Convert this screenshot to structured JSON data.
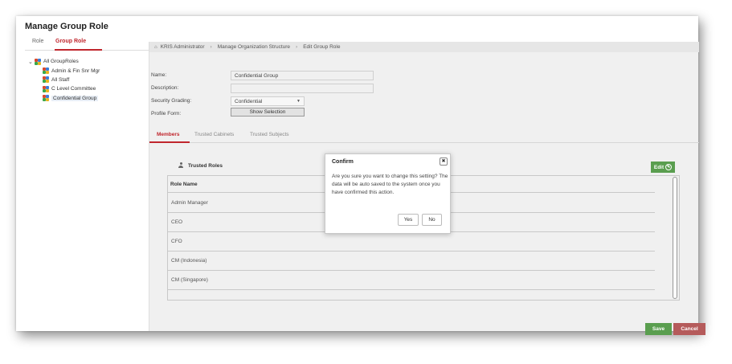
{
  "page": {
    "title": "Manage Group Role"
  },
  "left_tabs": [
    {
      "label": "Role"
    },
    {
      "label": "Group Role"
    }
  ],
  "tree": {
    "root": "All GroupRoles",
    "children": [
      "Admin & Fin Snr Mgr",
      "All Staff",
      "C Level Committee",
      "Confidential Group"
    ]
  },
  "breadcrumb": [
    "KRIS Administrator",
    "Manage Organization Structure",
    "Edit Group Role"
  ],
  "form": {
    "name_label": "Name:",
    "name_value": "Confidential Group",
    "description_label": "Description:",
    "description_value": "",
    "security_label": "Security Grading:",
    "security_value": "Confidential",
    "profile_label": "Profile Form:",
    "show_selection": "Show Selection"
  },
  "tabs": [
    {
      "label": "Members"
    },
    {
      "label": "Trusted Cabinets"
    },
    {
      "label": "Trusted Subjects"
    }
  ],
  "members": {
    "section_title": "Trusted Roles",
    "edit_label": "Edit",
    "column_header": "Role Name",
    "rows": [
      "Admin Manager",
      "CEO",
      "CFO",
      "CM (Indonesia)",
      "CM (Singapore)"
    ]
  },
  "actions": {
    "save": "Save",
    "cancel": "Cancel"
  },
  "dialog": {
    "title": "Confirm",
    "message": "Are you sure you want to change this setting? The data will be auto saved to the system once you have confirmed this action.",
    "yes": "Yes",
    "no": "No"
  },
  "colors": {
    "accent": "#c0262d",
    "save": "#5a9e4f",
    "cancel": "#b55b5b"
  }
}
